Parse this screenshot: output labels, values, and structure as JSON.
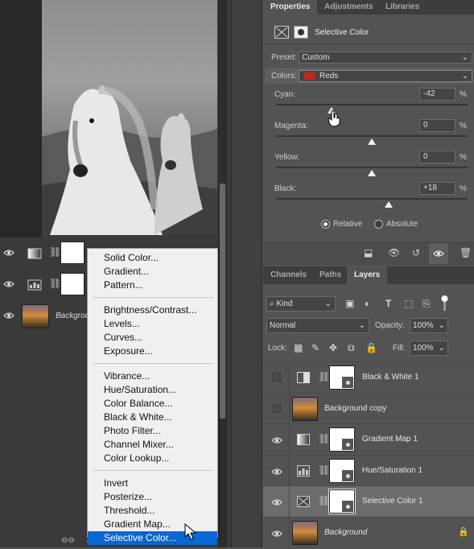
{
  "properties": {
    "tabs": [
      "Properties",
      "Adjustments",
      "Libraries"
    ],
    "header_title": "Selective Color",
    "preset_label": "Preset:",
    "preset_value": "Custom",
    "colors_label": "Colors:",
    "colors_value": "Reds",
    "colors_swatch": "#c0281e",
    "sliders": [
      {
        "label": "Cyan:",
        "value": "-42",
        "unit": "%",
        "fraction": 0.29
      },
      {
        "label": "Magenta:",
        "value": "0",
        "unit": "%",
        "fraction": 0.5
      },
      {
        "label": "Yellow:",
        "value": "0",
        "unit": "%",
        "fraction": 0.5
      },
      {
        "label": "Black:",
        "value": "+18",
        "unit": "%",
        "fraction": 0.59
      }
    ],
    "relative_label": "Relative",
    "absolute_label": "Absolute",
    "method_selected": "Relative"
  },
  "layers_panel": {
    "tabs": [
      "Channels",
      "Paths",
      "Layers"
    ],
    "filter_kind": "Kind",
    "blend_mode": "Normal",
    "opacity_label": "Opacity:",
    "opacity_value": "100%",
    "lock_label": "Lock:",
    "fill_label": "Fill:",
    "fill_value": "100%",
    "layers": [
      {
        "name": "Black & White 1",
        "visible": false,
        "type": "adjustment",
        "icon": "half-square-icon"
      },
      {
        "name": "Background copy",
        "visible": false,
        "type": "photo"
      },
      {
        "name": "Gradient Map 1",
        "visible": true,
        "type": "adjustment",
        "icon": "gradient-icon"
      },
      {
        "name": "Hue/Saturation 1",
        "visible": true,
        "type": "adjustment",
        "icon": "hue-sat-icon"
      },
      {
        "name": "Selective Color 1",
        "visible": true,
        "type": "adjustment",
        "icon": "selective-color-icon",
        "selected": true
      },
      {
        "name": "Background",
        "visible": true,
        "type": "photo",
        "locked": true
      }
    ]
  },
  "left_layers": {
    "background_label": "Backgroun"
  },
  "menu": {
    "groups": [
      [
        "Solid Color...",
        "Gradient...",
        "Pattern..."
      ],
      [
        "Brightness/Contrast...",
        "Levels...",
        "Curves...",
        "Exposure..."
      ],
      [
        "Vibrance...",
        "Hue/Saturation...",
        "Color Balance...",
        "Black & White...",
        "Photo Filter...",
        "Channel Mixer...",
        "Color Lookup..."
      ],
      [
        "Invert",
        "Posterize...",
        "Threshold...",
        "Gradient Map...",
        "Selective Color..."
      ]
    ],
    "selected": "Selective Color...",
    "highlight_color": "#0a66d2"
  }
}
